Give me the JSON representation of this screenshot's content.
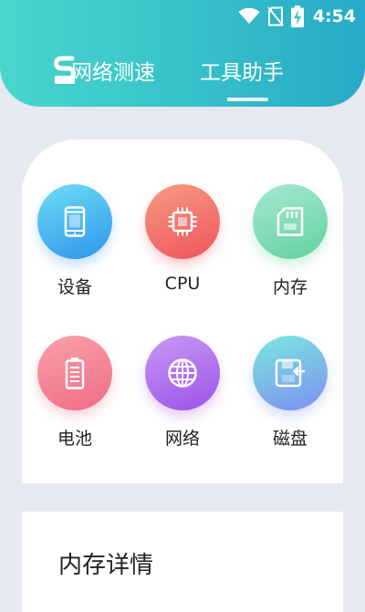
{
  "status_bar": {
    "time": "4:54",
    "icons": [
      "wifi-icon",
      "no-sim-icon",
      "battery-charging-icon"
    ]
  },
  "header": {
    "tabs": [
      {
        "label": "网络测速",
        "icon": "speed-tab-icon"
      },
      {
        "label": "工具助手",
        "active": true
      }
    ]
  },
  "tools": [
    {
      "label": "设备",
      "icon": "phone-icon"
    },
    {
      "label": "CPU",
      "icon": "cpu-chip-icon"
    },
    {
      "label": "内存",
      "icon": "memory-card-icon"
    },
    {
      "label": "电池",
      "icon": "battery-icon"
    },
    {
      "label": "网络",
      "icon": "globe-icon"
    },
    {
      "label": "磁盘",
      "icon": "disk-icon"
    }
  ],
  "detail": {
    "title": "内存详情"
  },
  "colors": {
    "header_start": "#49d6cd",
    "header_end": "#27a9c7",
    "background": "#e6e9f0"
  }
}
